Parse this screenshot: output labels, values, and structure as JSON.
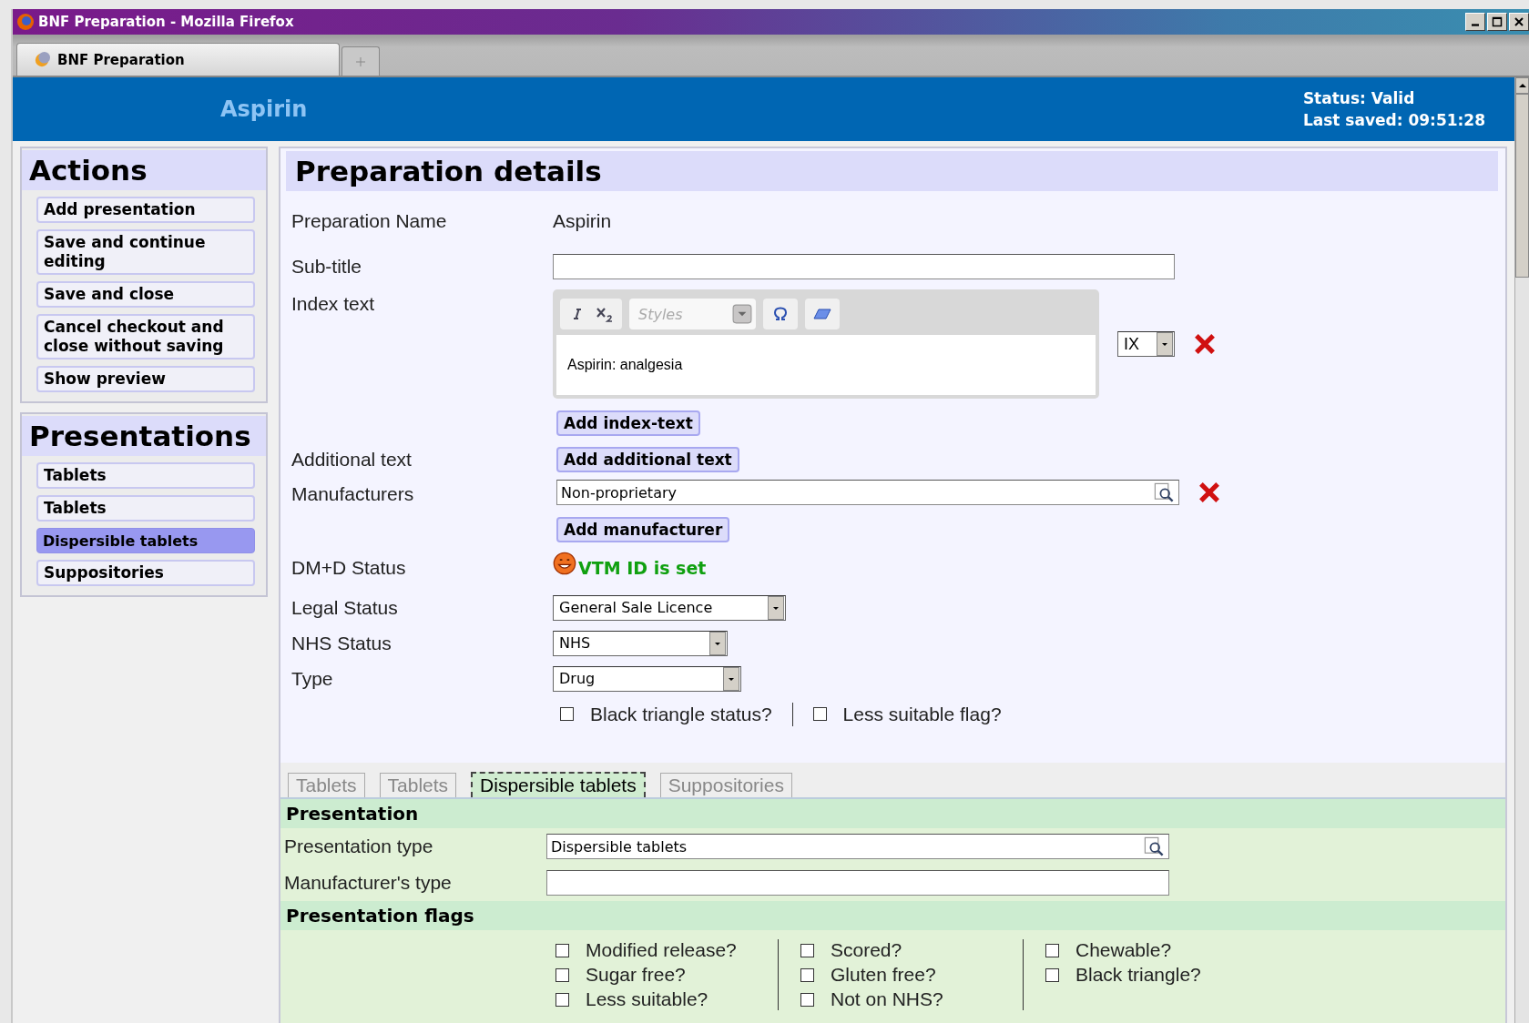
{
  "window": {
    "title": "BNF Preparation - Mozilla Firefox"
  },
  "browser_tab": {
    "title": "BNF Preparation"
  },
  "header": {
    "title": "Aspirin",
    "status": "Status: Valid",
    "last_saved": "Last saved: 09:51:28"
  },
  "actions": {
    "heading": "Actions",
    "items": [
      {
        "label": "Add presentation"
      },
      {
        "label": "Save and continue editing"
      },
      {
        "label": "Save and close"
      },
      {
        "label": "Cancel checkout and close without saving"
      },
      {
        "label": "Show preview"
      }
    ]
  },
  "presentations": {
    "heading": "Presentations",
    "items": [
      {
        "label": "Tablets",
        "selected": false
      },
      {
        "label": "Tablets",
        "selected": false
      },
      {
        "label": "Dispersible tablets",
        "selected": true
      },
      {
        "label": "Suppositories",
        "selected": false
      }
    ]
  },
  "details": {
    "heading": "Preparation details",
    "preparation_name": {
      "label": "Preparation Name",
      "value": "Aspirin"
    },
    "subtitle": {
      "label": "Sub-title"
    },
    "index_text": {
      "label": "Index text",
      "styles_placeholder": "Styles",
      "content": "Aspirin: analgesia",
      "index_type": "IX",
      "add_button": "Add index-text"
    },
    "additional_text": {
      "label": "Additional text",
      "add_button": "Add additional text"
    },
    "manufacturers": {
      "label": "Manufacturers",
      "value": "Non-proprietary",
      "add_button": "Add manufacturer"
    },
    "dmd_status": {
      "label": "DM+D Status",
      "value": "VTM ID is set"
    },
    "legal_status": {
      "label": "Legal Status",
      "value": "General Sale Licence"
    },
    "nhs_status": {
      "label": "NHS Status",
      "value": "NHS"
    },
    "type": {
      "label": "Type",
      "value": "Drug"
    },
    "flags": [
      {
        "label": "Black triangle status?",
        "checked": false
      },
      {
        "label": "Less suitable flag?",
        "checked": false
      }
    ]
  },
  "presentation_tabs": [
    {
      "label": "Tablets",
      "selected": false
    },
    {
      "label": "Tablets",
      "selected": false
    },
    {
      "label": "Dispersible tablets",
      "selected": true
    },
    {
      "label": "Suppositories",
      "selected": false
    }
  ],
  "presentation": {
    "heading": "Presentation",
    "type_label": "Presentation type",
    "type_value": "Dispersible tablets",
    "manufacturer_type_label": "Manufacturer's type"
  },
  "presentation_flags": {
    "heading": "Presentation flags",
    "columns": [
      [
        {
          "label": "Modified release?",
          "checked": false
        },
        {
          "label": "Sugar free?",
          "checked": false
        },
        {
          "label": "Less suitable?",
          "checked": false
        }
      ],
      [
        {
          "label": "Scored?",
          "checked": false
        },
        {
          "label": "Gluten free?",
          "checked": false
        },
        {
          "label": "Not on NHS?",
          "checked": false
        }
      ],
      [
        {
          "label": "Chewable?",
          "checked": false
        },
        {
          "label": "Black triangle?",
          "checked": false
        }
      ]
    ]
  }
}
